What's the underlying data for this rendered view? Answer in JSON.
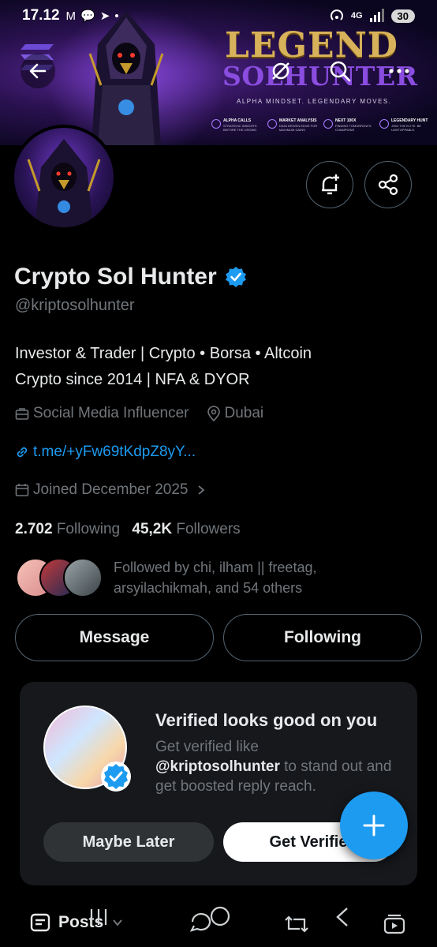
{
  "status_bar": {
    "time": "17.12",
    "network": "4G",
    "battery": "30"
  },
  "banner": {
    "title": "LEGEND",
    "subtitle": "SOLHUNTER",
    "tagline": "ALPHA MINDSET. LEGENDARY MOVES.",
    "features": [
      {
        "title": "ALPHA CALLS",
        "desc": "STRATEGIC INSIGHTS BEFORE THE CROWD"
      },
      {
        "title": "MARKET ANALYSIS",
        "desc": "DATA DRIVEN EDGE FOR MAXIMUM GAINS"
      },
      {
        "title": "NEXT 100X",
        "desc": "FINDING TOMORROW'S CHAMPIONS"
      },
      {
        "title": "LEGENDARY HUNT",
        "desc": "JOIN THE ELITE. BE UNSTOPPABLE."
      }
    ]
  },
  "profile": {
    "name": "Crypto Sol Hunter",
    "handle": "@kriptosolhunter",
    "bio_line1": "Investor & Trader | Crypto • Borsa • Altcoin",
    "bio_line2": "Crypto since 2014 | NFA & DYOR",
    "category": "Social Media Influencer",
    "location": "Dubai",
    "link": "t.me/+yFw69tKdpZ8yY...",
    "joined": "Joined December 2025",
    "following_count": "2.702",
    "following_label": "Following",
    "followers_count": "45,2K",
    "followers_label": "Followers",
    "followed_by_line1": "Followed by chi, ilham || freetag,",
    "followed_by_line2": "arsyilachikmah, and 54 others"
  },
  "actions": {
    "message": "Message",
    "following": "Following"
  },
  "verify_card": {
    "title": "Verified looks good on you",
    "desc_prefix": "Get verified like",
    "desc_handle": "@kriptosolhunter",
    "desc_suffix": "to stand out and get boosted reply reach.",
    "maybe_later": "Maybe Later",
    "get_verified": "Get Verifie"
  },
  "bottom": {
    "tab_posts": "Posts"
  },
  "colors": {
    "accent": "#1d9bf0",
    "muted": "#71767b",
    "text": "#e7e9ea",
    "card": "#16181c"
  }
}
